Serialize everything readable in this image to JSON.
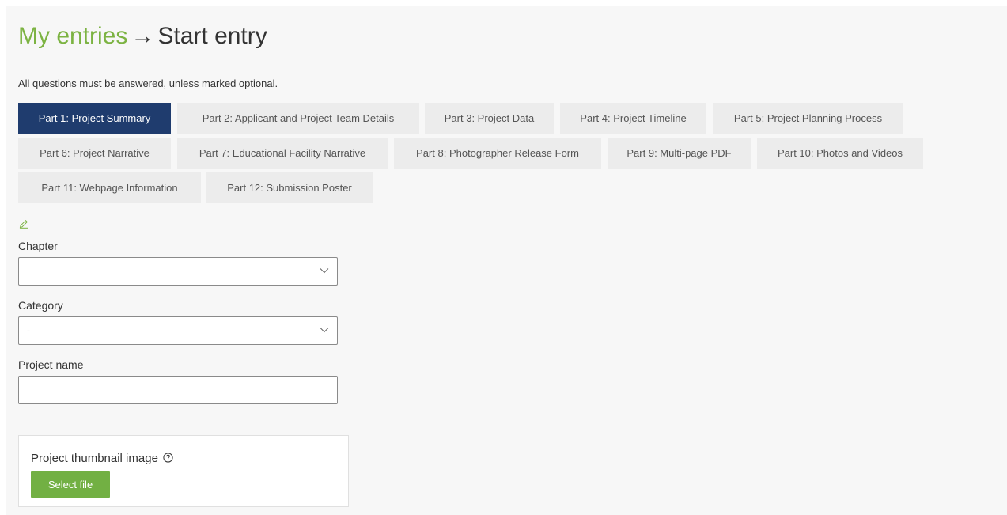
{
  "breadcrumb": {
    "parent": "My entries",
    "arrow": "→",
    "current": "Start entry"
  },
  "notice": "All questions must be answered, unless marked optional.",
  "tabs": [
    "Part 1: Project Summary",
    "Part 2: Applicant and Project Team Details",
    "Part 3: Project Data",
    "Part 4: Project Timeline",
    "Part 5: Project Planning Process",
    "Part 6: Project Narrative",
    "Part 7: Educational Facility Narrative",
    "Part 8: Photographer Release Form",
    "Part 9: Multi-page PDF",
    "Part 10: Photos and Videos",
    "Part 11: Webpage Information",
    "Part 12: Submission Poster"
  ],
  "active_tab": "Part 1: Project Summary",
  "icons": {
    "edit": "pencil-icon",
    "dropdown": "chevron-down-icon",
    "help": "help-circle-icon"
  },
  "form": {
    "chapter": {
      "label": "Chapter",
      "value": ""
    },
    "category": {
      "label": "Category",
      "value": "-"
    },
    "project_name": {
      "label": "Project name",
      "value": ""
    },
    "thumbnail": {
      "label": "Project thumbnail image",
      "button": "Select file"
    }
  },
  "colors": {
    "accent_green": "#7cb342",
    "button_green": "#72b043",
    "active_tab": "#1f3c6e",
    "tab_bg": "#ececec"
  }
}
